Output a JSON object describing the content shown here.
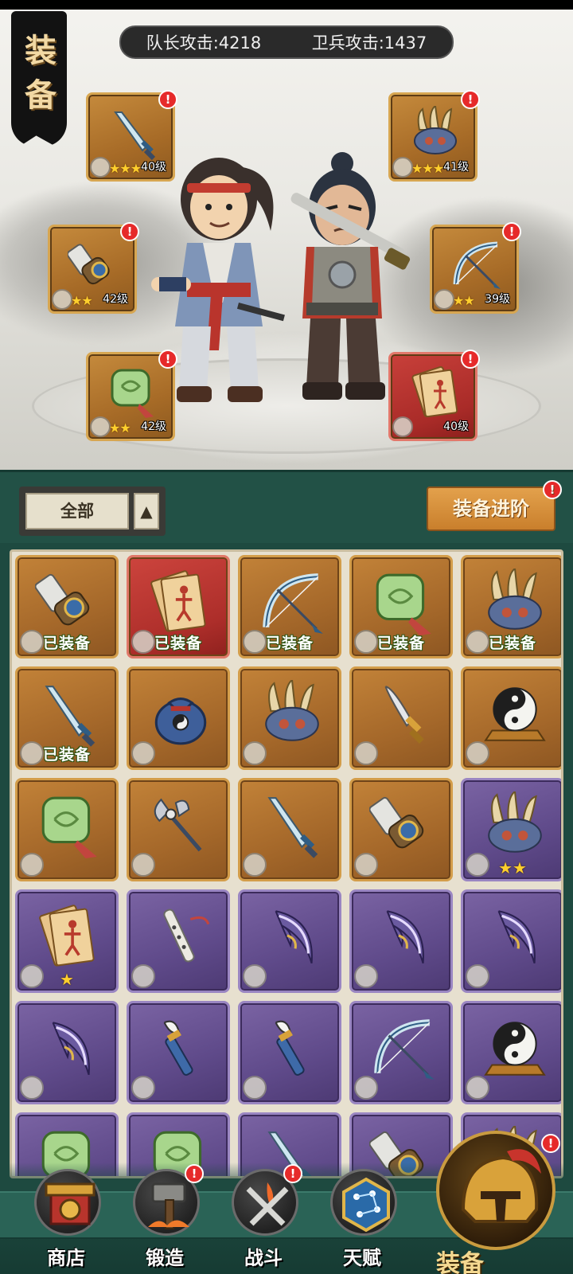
{
  "hero": {
    "title": "装备",
    "attack": {
      "captain_label": "队长攻击:4218",
      "guard_label": "卫兵攻击:1437"
    },
    "slots": [
      {
        "item": "sword",
        "stars": "★★★",
        "level": "40级",
        "alert": "!"
      },
      {
        "item": "claw",
        "stars": "★★★",
        "level": "41级",
        "alert": "!"
      },
      {
        "item": "cannon",
        "stars": "★★",
        "level": "42级",
        "alert": "!"
      },
      {
        "item": "bow",
        "stars": "★★",
        "level": "39级",
        "alert": "!"
      },
      {
        "item": "jade-pendant",
        "stars": "★★",
        "level": "42级",
        "alert": "!"
      },
      {
        "item": "scroll",
        "stars": "",
        "level": "40级",
        "alert": "!"
      }
    ]
  },
  "filter": {
    "selected": "全部",
    "arrow": "▲",
    "advance_label": "装备进阶",
    "advance_alert": "!"
  },
  "inventory": {
    "equipped_label": "已装备",
    "items": [
      {
        "item": "cannon",
        "rarity": "gold",
        "equipped": true
      },
      {
        "item": "scroll",
        "rarity": "red",
        "equipped": true
      },
      {
        "item": "bow",
        "rarity": "gold",
        "equipped": true
      },
      {
        "item": "jade-pendant",
        "rarity": "gold",
        "equipped": true
      },
      {
        "item": "claw",
        "rarity": "gold",
        "equipped": true
      },
      {
        "item": "sword",
        "rarity": "gold",
        "equipped": true
      },
      {
        "item": "pouch",
        "rarity": "gold",
        "equipped": false
      },
      {
        "item": "claw",
        "rarity": "gold",
        "equipped": false
      },
      {
        "item": "dagger",
        "rarity": "gold",
        "equipped": false
      },
      {
        "item": "yin-yang",
        "rarity": "gold",
        "equipped": false
      },
      {
        "item": "jade-pendant",
        "rarity": "gold",
        "equipped": false
      },
      {
        "item": "axe",
        "rarity": "gold",
        "equipped": false
      },
      {
        "item": "sword",
        "rarity": "gold",
        "equipped": false
      },
      {
        "item": "cannon",
        "rarity": "gold",
        "equipped": false
      },
      {
        "item": "claw",
        "rarity": "purple",
        "equipped": false,
        "stars": "★★"
      },
      {
        "item": "scroll",
        "rarity": "purple",
        "equipped": false,
        "stars": "★"
      },
      {
        "item": "flute",
        "rarity": "purple",
        "equipped": false
      },
      {
        "item": "crescent-blade",
        "rarity": "purple",
        "equipped": false
      },
      {
        "item": "crescent-blade",
        "rarity": "purple",
        "equipped": false
      },
      {
        "item": "crescent-blade",
        "rarity": "purple",
        "equipped": false
      },
      {
        "item": "crescent-blade",
        "rarity": "purple",
        "equipped": false
      },
      {
        "item": "brush",
        "rarity": "purple",
        "equipped": false
      },
      {
        "item": "brush",
        "rarity": "purple",
        "equipped": false
      },
      {
        "item": "bow",
        "rarity": "purple",
        "equipped": false
      },
      {
        "item": "yin-yang",
        "rarity": "purple",
        "equipped": false
      },
      {
        "item": "jade-pendant",
        "rarity": "purple",
        "equipped": false
      },
      {
        "item": "jade-pendant",
        "rarity": "purple",
        "equipped": false
      },
      {
        "item": "sword",
        "rarity": "purple",
        "equipped": false
      },
      {
        "item": "cannon",
        "rarity": "purple",
        "equipped": false
      },
      {
        "item": "claw",
        "rarity": "purple",
        "equipped": false
      }
    ]
  },
  "nav": {
    "shop": "商店",
    "forge": "锻造",
    "battle": "战斗",
    "talent": "天赋",
    "equip": "装备",
    "alert": "!"
  },
  "colors": {
    "gold_tile": "#a76b27",
    "red_tile": "#ad2e2a",
    "purple_tile": "#5f4a8a",
    "panel_green": "#225146",
    "star": "#ffcf2d"
  }
}
